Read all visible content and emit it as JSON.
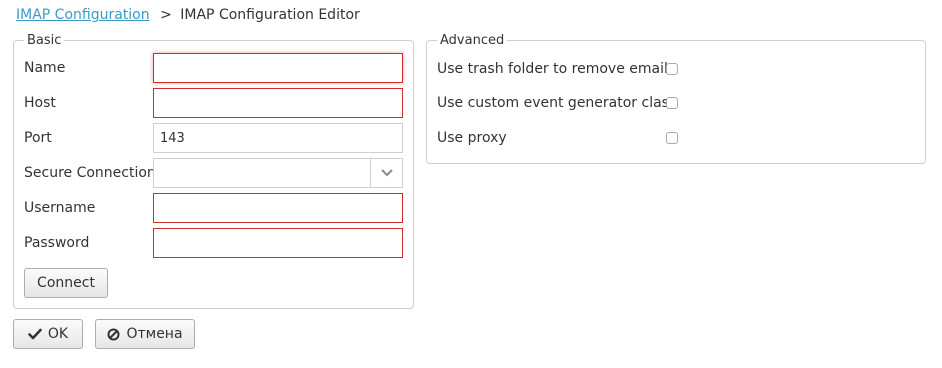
{
  "breadcrumb": {
    "parent": "IMAP Configuration",
    "separator": ">",
    "current": "IMAP Configuration Editor"
  },
  "basic": {
    "legend": "Basic",
    "name": {
      "label": "Name",
      "value": "",
      "state": "invalid-focused"
    },
    "host": {
      "label": "Host",
      "value": "",
      "state": "invalid"
    },
    "port": {
      "label": "Port",
      "value": "143"
    },
    "secure": {
      "label": "Secure Connection",
      "value": "",
      "icon": "chevron-down-icon"
    },
    "username": {
      "label": "Username",
      "value": "",
      "state": "invalid"
    },
    "password": {
      "label": "Password",
      "value": "",
      "state": "invalid"
    },
    "connect_label": "Connect"
  },
  "advanced": {
    "legend": "Advanced",
    "trash": {
      "label": "Use trash folder to remove emails",
      "checked": false
    },
    "custom_event": {
      "label": "Use custom event generator class",
      "checked": false
    },
    "proxy": {
      "label": "Use proxy",
      "checked": false
    }
  },
  "actions": {
    "ok_label": "OK",
    "ok_icon": "check-icon",
    "cancel_label": "Отмена",
    "cancel_icon": "ban-icon"
  },
  "colors": {
    "link": "#3a9bc8",
    "invalid_border": "#c9302c",
    "border": "#cfcfcf"
  }
}
